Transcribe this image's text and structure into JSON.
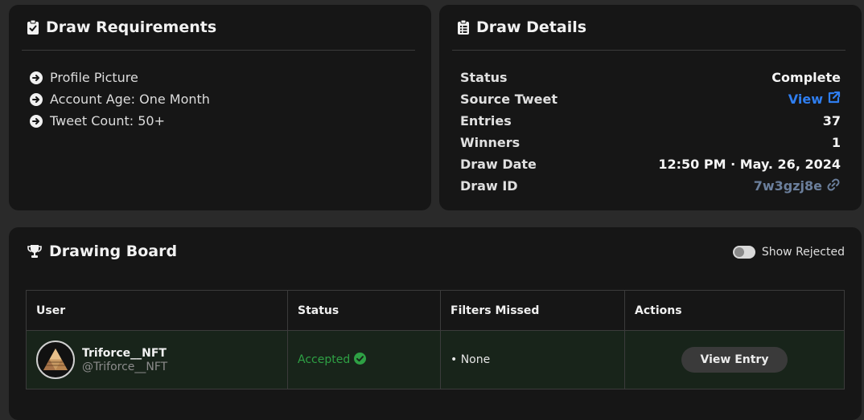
{
  "requirements": {
    "title": "Draw Requirements",
    "items": [
      {
        "label": "Profile Picture"
      },
      {
        "label": "Account Age: One Month"
      },
      {
        "label": "Tweet Count: 50+"
      }
    ]
  },
  "details": {
    "title": "Draw Details",
    "rows": [
      {
        "label": "Status",
        "value": "Complete"
      },
      {
        "label": "Source Tweet",
        "value": "View"
      },
      {
        "label": "Entries",
        "value": "37"
      },
      {
        "label": "Winners",
        "value": "1"
      },
      {
        "label": "Draw Date",
        "value": "12:50 PM · May. 26, 2024"
      },
      {
        "label": "Draw ID",
        "value": "7w3gzj8e"
      }
    ]
  },
  "board": {
    "title": "Drawing Board",
    "toggle_label": "Show Rejected",
    "toggle_on": false,
    "columns": [
      "User",
      "Status",
      "Filters Missed",
      "Actions"
    ],
    "rows": [
      {
        "display_name": "Triforce__NFT",
        "handle": "@Triforce__NFT",
        "status": "Accepted",
        "filters_missed": "• None",
        "action_label": "View Entry"
      }
    ]
  },
  "colors": {
    "background": "#2a2a2a",
    "card": "#161616",
    "link": "#2f7ef0",
    "muted_link": "#6b7f9c",
    "accepted": "#2ea044",
    "accepted_row": "#18241a"
  },
  "icons": {
    "requirements_header": "clipboard-check-icon",
    "details_header": "clipboard-list-icon",
    "board_header": "trophy-icon",
    "requirement_bullet": "arrow-circle-right-icon",
    "source_tweet": "external-link-icon",
    "draw_id": "link-icon",
    "accepted": "check-circle-icon"
  }
}
